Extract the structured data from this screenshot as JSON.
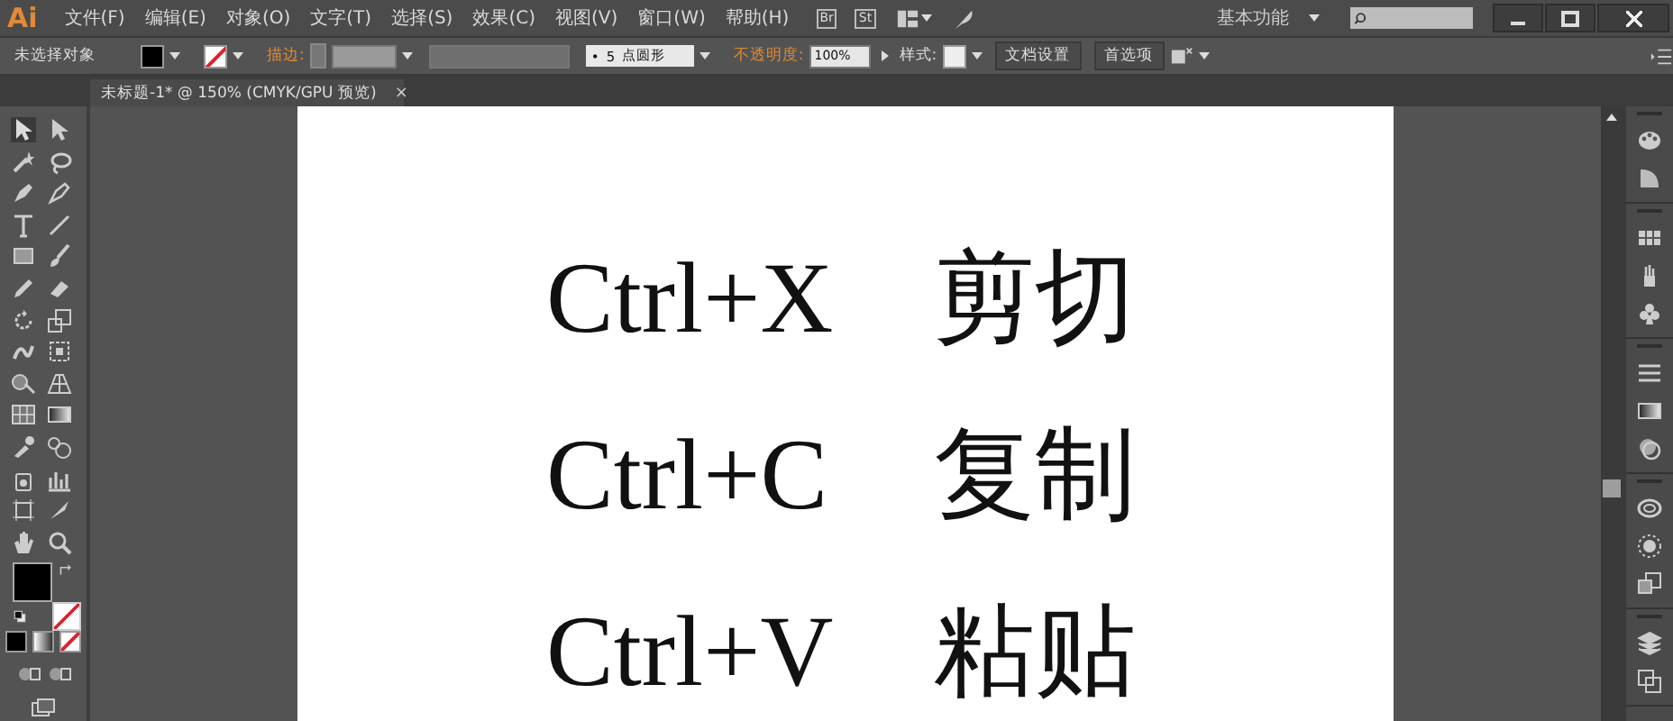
{
  "app": {
    "logo": "Ai",
    "menus": [
      "文件(F)",
      "编辑(E)",
      "对象(O)",
      "文字(T)",
      "选择(S)",
      "效果(C)",
      "视图(V)",
      "窗口(W)",
      "帮助(H)"
    ],
    "bridge_buttons": [
      "Br",
      "St"
    ],
    "workspace": "基本功能"
  },
  "control_bar": {
    "selection": "未选择对象",
    "stroke_label": "描边:",
    "brush": {
      "dot": "•",
      "size": "5",
      "name": "点圆形"
    },
    "opacity_label": "不透明度:",
    "opacity": "100%",
    "style_label": "样式:",
    "buttons": [
      "文档设置",
      "首选项"
    ]
  },
  "document_tab": {
    "title": "未标题-1* @ 150% (CMYK/GPU 预览)",
    "close": "×"
  },
  "artboard": {
    "lines": [
      {
        "shortcut": "Ctrl+X",
        "action": "剪切"
      },
      {
        "shortcut": "Ctrl+C",
        "action": "复制"
      },
      {
        "shortcut": "Ctrl+V",
        "action": "粘贴"
      }
    ]
  }
}
